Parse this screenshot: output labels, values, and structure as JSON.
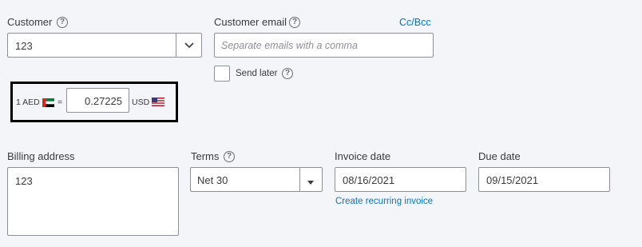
{
  "customer": {
    "label": "Customer",
    "help_icon": "?",
    "value": "123",
    "dropdown_icon": "chevron-down"
  },
  "customer_email": {
    "label": "Customer email",
    "help_icon": "?",
    "cc_bcc_link": "Cc/Bcc",
    "placeholder": "Separate emails with a comma",
    "value": ""
  },
  "send_later": {
    "label": "Send later",
    "help_icon": "?",
    "checked": false
  },
  "exchange_rate": {
    "from_text": "1 AED",
    "equals": "=",
    "rate": "0.27225",
    "to_text": "USD"
  },
  "billing_address": {
    "label": "Billing address",
    "value": "123"
  },
  "terms": {
    "label": "Terms",
    "help_icon": "?",
    "value": "Net 30",
    "dropdown_icon": "triangle-down"
  },
  "invoice_date": {
    "label": "Invoice date",
    "value": "08/16/2021",
    "recurring_link": "Create recurring invoice"
  },
  "due_date": {
    "label": "Due date",
    "value": "09/15/2021"
  },
  "colors": {
    "background": "#f4f5f8",
    "link": "#0077c5",
    "border": "#8d9096",
    "highlight_frame": "#000000"
  }
}
